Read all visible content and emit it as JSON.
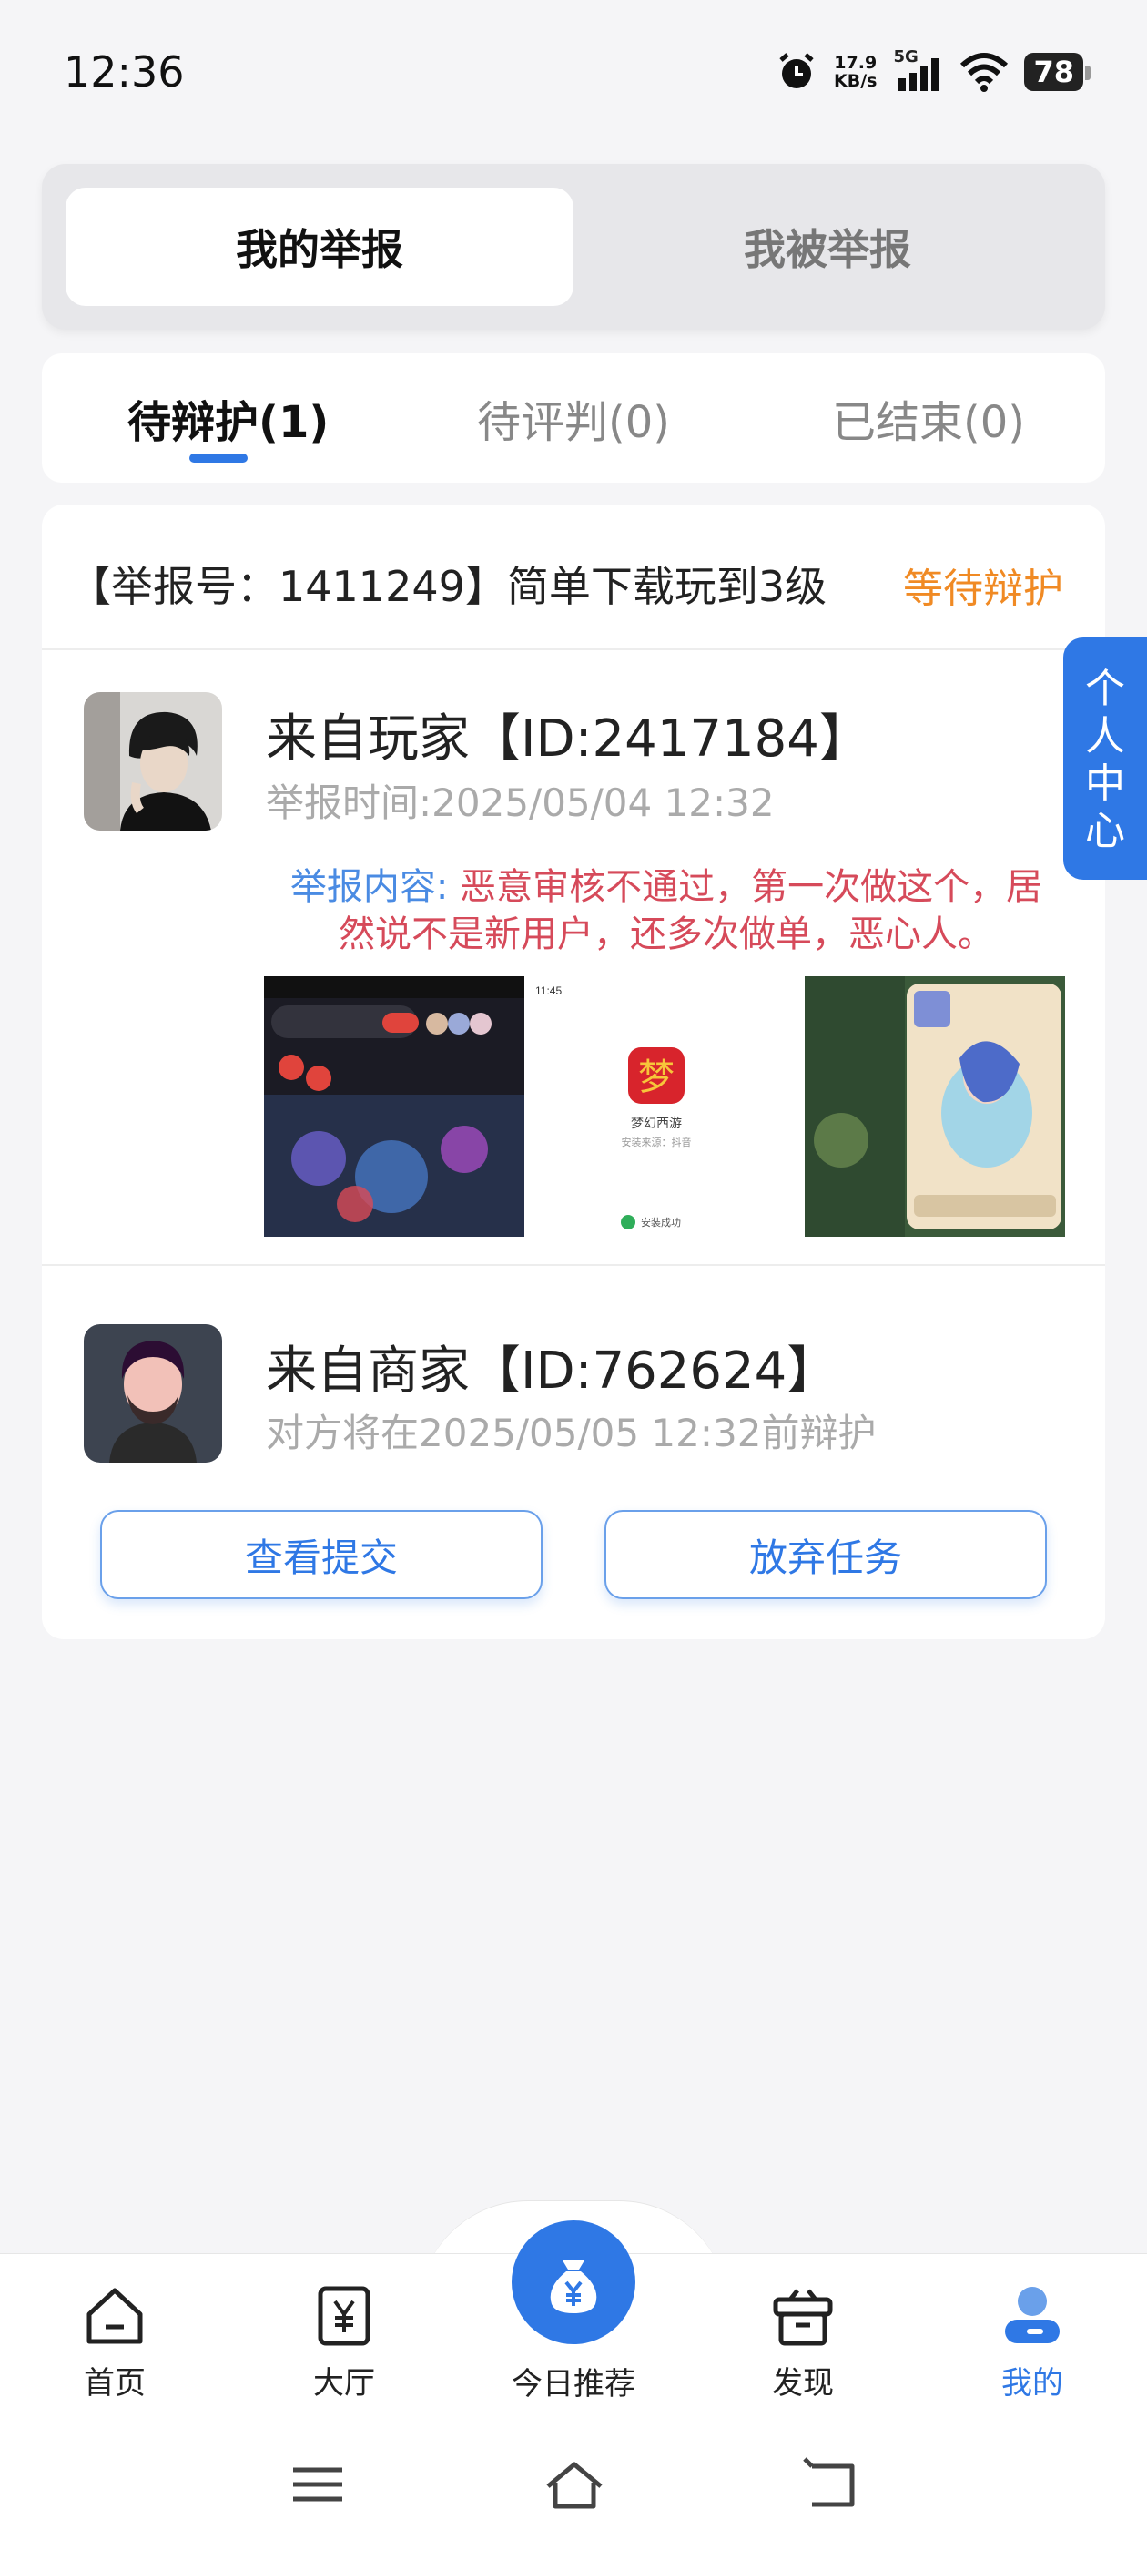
{
  "status_bar": {
    "time": "12:36",
    "speed_value": "17.9",
    "speed_unit": "KB/s",
    "network": "5G",
    "battery": "78"
  },
  "segment_tabs": {
    "mine": "我的举报",
    "reported": "我被举报"
  },
  "status_tabs": [
    {
      "label": "待辩护(1)",
      "active": true
    },
    {
      "label": "待评判(0)",
      "active": false
    },
    {
      "label": "已结束(0)",
      "active": false
    }
  ],
  "report": {
    "header": "【举报号：1411249】简单下载玩到3级",
    "status": "等待辩护",
    "reporter_title": "来自玩家【ID:2417184】",
    "report_time": "举报时间:2025/05/04 12:32",
    "content_label": "举报内容:",
    "content_text": "恶意审核不通过，第一次做这个，居然说不是新用户，还多次做单，恶心人。",
    "thumb2_time": "11:45",
    "thumb2_app": "梦幻西游",
    "thumb2_source": "安装来源：抖音",
    "thumb2_status": "安装成功",
    "merchant_title": "来自商家【ID:762624】",
    "defense_deadline": "对方将在2025/05/05 12:32前辩护",
    "view_button": "查看提交",
    "abandon_button": "放弃任务"
  },
  "float_button": "个人中心",
  "bottom_nav": {
    "home": "首页",
    "hall": "大厅",
    "recommend": "今日推荐",
    "discover": "发现",
    "mine": "我的"
  },
  "colors": {
    "accent": "#2f78e5",
    "warning": "#f08a24",
    "content_red": "#d64a5a"
  }
}
